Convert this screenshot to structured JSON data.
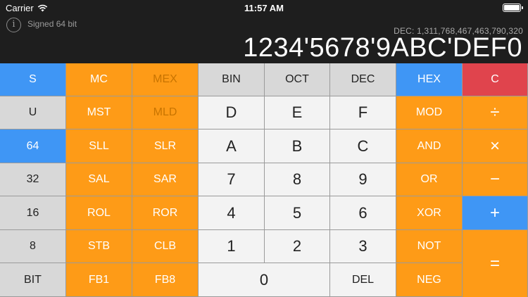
{
  "status_bar": {
    "carrier": "Carrier",
    "time": "11:57 AM",
    "wifi_icon": "wifi-icon",
    "battery_icon": "battery-icon"
  },
  "display": {
    "info_icon": "info-icon",
    "info_glyph": "i",
    "mode_label": "Signed 64 bit",
    "dec_readout": "DEC: 1,311,768,467,463,790,320",
    "value": "1234'5678'9ABC'DEF0"
  },
  "keys": {
    "col0": {
      "r0": "S",
      "r1": "U",
      "r2": "64",
      "r3": "32",
      "r4": "16",
      "r5": "8",
      "r6": "BIT"
    },
    "col1": {
      "r0": "MC",
      "r1": "MST",
      "r2": "SLL",
      "r3": "SAL",
      "r4": "ROL",
      "r5": "STB",
      "r6": "FB1"
    },
    "col2": {
      "r0": "MEX",
      "r1": "MLD",
      "r2": "SLR",
      "r3": "SAR",
      "r4": "ROR",
      "r5": "CLB",
      "r6": "FB8"
    },
    "col3": {
      "r0": "BIN",
      "r1": "D",
      "r2": "A",
      "r3": "7",
      "r4": "4",
      "r5": "1",
      "r6": "0"
    },
    "col4": {
      "r0": "OCT",
      "r1": "E",
      "r2": "B",
      "r3": "8",
      "r4": "5",
      "r5": "2"
    },
    "col5": {
      "r0": "DEC",
      "r1": "F",
      "r2": "C",
      "r3": "9",
      "r4": "6",
      "r5": "3",
      "r6": "DEL"
    },
    "col6": {
      "r0": "HEX",
      "r1": "MOD",
      "r2": "AND",
      "r3": "OR",
      "r4": "XOR",
      "r5": "NOT",
      "r6": "NEG"
    },
    "col7": {
      "r0": "C",
      "r1": "÷",
      "r2": "×",
      "r3": "−",
      "r4": "+",
      "r5": "="
    }
  },
  "colors": {
    "orange": "#fe9b17",
    "blue": "#3f96f5",
    "red": "#e0444d",
    "gray": "#d8d8d8",
    "light": "#f3f3f3",
    "display_bg": "#1e1e1e"
  }
}
